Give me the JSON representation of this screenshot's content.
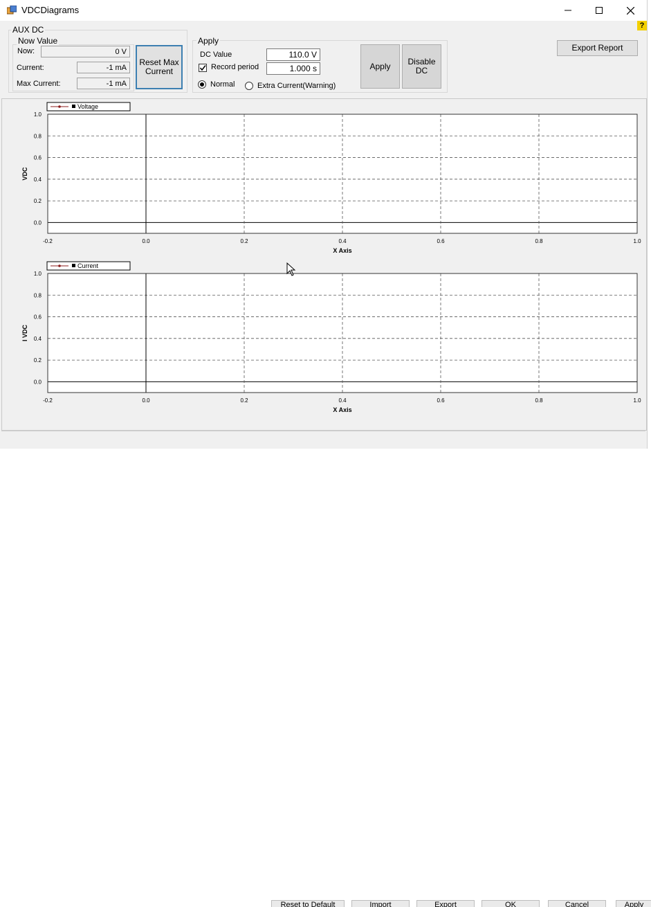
{
  "window": {
    "title": "VDCDiagrams"
  },
  "aux_dc": {
    "title": "AUX DC",
    "now_value": {
      "title": "Now Value",
      "now_label": "Now:",
      "now_value": "0 V",
      "current_label": "Current:",
      "current_value": "-1 mA",
      "max_current_label": "Max Current:",
      "max_current_value": "-1 mA"
    },
    "reset_max_current_label": "Reset Max Current"
  },
  "apply_group": {
    "title": "Apply",
    "dc_value_label": "DC Value",
    "dc_value": "110.0 V",
    "record_period_label": "Record period",
    "record_period_checked": true,
    "record_period_value": "1.000 s",
    "normal_label": "Normal",
    "extra_current_label": "Extra Current(Warning)",
    "selected_mode": "Normal",
    "apply_button": "Apply",
    "disable_dc_button": "Disable DC"
  },
  "export_report_button": "Export Report",
  "help_label": "?",
  "background_buttons": [
    "Reset to Default",
    "Import",
    "Export",
    "OK",
    "Cancel",
    "Apply"
  ],
  "chart_data": [
    {
      "type": "line",
      "legend": "Voltage",
      "series": [
        {
          "name": "Voltage",
          "x": [],
          "y": [],
          "color": "#8b1a1a"
        }
      ],
      "xlabel": "X Axis",
      "ylabel": "VDC",
      "xlim": [
        -0.2,
        1.0
      ],
      "ylim": [
        -0.1,
        1.0
      ],
      "xticks": [
        "-0.2",
        "0.0",
        "0.2",
        "0.4",
        "0.6",
        "0.8",
        "1.0"
      ],
      "yticks": [
        "0.0",
        "0.2",
        "0.4",
        "0.6",
        "0.8",
        "1.0"
      ],
      "grid": true
    },
    {
      "type": "line",
      "legend": "Current",
      "series": [
        {
          "name": "Current",
          "x": [],
          "y": [],
          "color": "#8b1a1a"
        }
      ],
      "xlabel": "X Axis",
      "ylabel": "I VDC",
      "xlim": [
        -0.2,
        1.0
      ],
      "ylim": [
        -0.1,
        1.0
      ],
      "xticks": [
        "-0.2",
        "0.0",
        "0.2",
        "0.4",
        "0.6",
        "0.8",
        "1.0"
      ],
      "yticks": [
        "0.0",
        "0.2",
        "0.4",
        "0.6",
        "0.8",
        "1.0"
      ],
      "grid": true
    }
  ]
}
